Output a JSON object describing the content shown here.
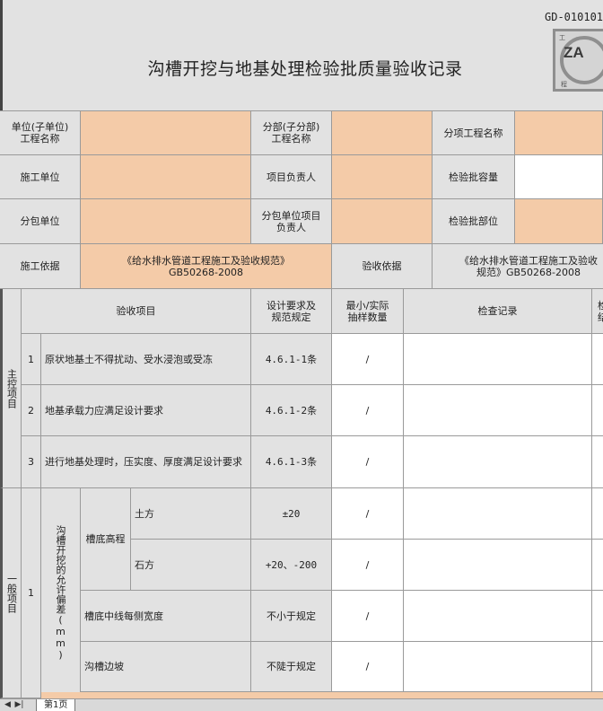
{
  "doc": {
    "code": "GD-010101",
    "title": "沟槽开挖与地基处理检验批质量验收记录",
    "logo": {
      "text": "ZA",
      "top_char": "工",
      "bottom_char": "程"
    }
  },
  "header": {
    "unit_label": "单位(子单位)\n工程名称",
    "division_label": "分部(子分部)\n工程名称",
    "subitem_label": "分项工程名称",
    "contractor_label": "施工单位",
    "pm_label": "项目负责人",
    "capacity_label": "检验批容量",
    "subcontractor_label": "分包单位",
    "sub_pm_label": "分包单位项目\n负责人",
    "location_label": "检验批部位",
    "basis_label": "施工依据",
    "basis_value": "《给水排水管道工程施工及验收规范》\nGB50268-2008",
    "acceptance_basis_label": "验收依据",
    "acceptance_basis_value": "《给水排水管道工程施工及验收\n规范》GB50268-2008"
  },
  "table": {
    "col_item": "验收项目",
    "col_design": "设计要求及\n规范规定",
    "col_sample": "最小/实际\n抽样数量",
    "col_record": "检查记录",
    "col_result": "检查\n结果",
    "main_control_label": "主控项目",
    "general_label": "一般项目",
    "main_items": [
      {
        "no": "1",
        "text": "原状地基土不得扰动、受水浸泡或受冻",
        "spec": "4.6.1-1条",
        "sample": "/"
      },
      {
        "no": "2",
        "text": "地基承载力应满足设计要求",
        "spec": "4.6.1-2条",
        "sample": "/"
      },
      {
        "no": "3",
        "text": "进行地基处理时，压实度、厚度满足设计要求",
        "spec": "4.6.1-3条",
        "sample": "/"
      }
    ],
    "general": {
      "no": "1",
      "group_label": "沟槽开挖的允许偏差(mm)",
      "bottom_elev_label": "槽底高程",
      "earth_label": "土方",
      "earth_spec": "±20",
      "rock_label": "石方",
      "rock_spec": "+20、-200",
      "centerline_label": "槽底中线每侧宽度",
      "centerline_spec": "不小于规定",
      "slope_label": "沟槽边坡",
      "slope_spec": "不陡于规定",
      "sample": "/"
    }
  },
  "sheet_tabs": {
    "active": "第1页"
  }
}
